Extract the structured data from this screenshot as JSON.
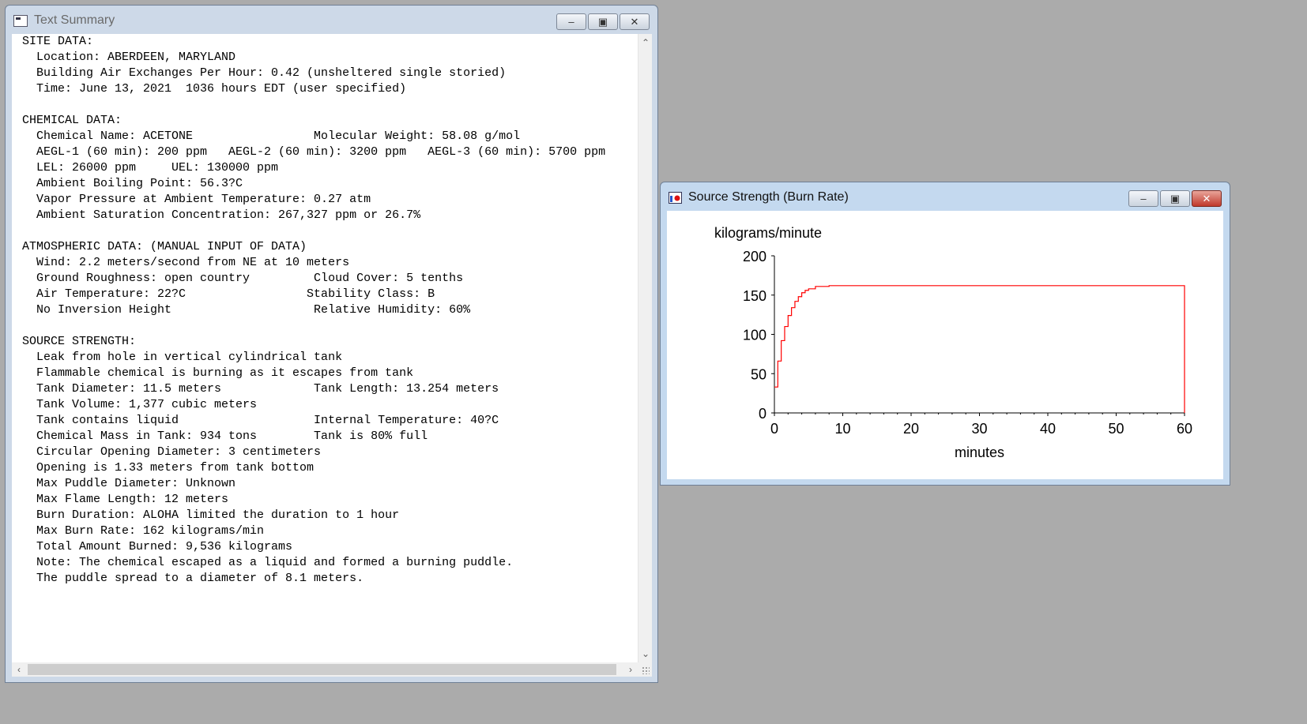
{
  "text_window": {
    "title": "Text Summary",
    "lines": [
      "SITE DATA:",
      "  Location: ABERDEEN, MARYLAND",
      "  Building Air Exchanges Per Hour: 0.42 (unsheltered single storied)",
      "  Time: June 13, 2021  1036 hours EDT (user specified)",
      "",
      "CHEMICAL DATA:",
      "  Chemical Name: ACETONE                 Molecular Weight: 58.08 g/mol",
      "  AEGL-1 (60 min): 200 ppm   AEGL-2 (60 min): 3200 ppm   AEGL-3 (60 min): 5700 ppm",
      "  LEL: 26000 ppm     UEL: 130000 ppm",
      "  Ambient Boiling Point: 56.3?C",
      "  Vapor Pressure at Ambient Temperature: 0.27 atm",
      "  Ambient Saturation Concentration: 267,327 ppm or 26.7%",
      "",
      "ATMOSPHERIC DATA: (MANUAL INPUT OF DATA)",
      "  Wind: 2.2 meters/second from NE at 10 meters",
      "  Ground Roughness: open country         Cloud Cover: 5 tenths",
      "  Air Temperature: 22?C                 Stability Class: B",
      "  No Inversion Height                    Relative Humidity: 60%",
      "",
      "SOURCE STRENGTH:",
      "  Leak from hole in vertical cylindrical tank",
      "  Flammable chemical is burning as it escapes from tank",
      "  Tank Diameter: 11.5 meters             Tank Length: 13.254 meters",
      "  Tank Volume: 1,377 cubic meters",
      "  Tank contains liquid                   Internal Temperature: 40?C",
      "  Chemical Mass in Tank: 934 tons        Tank is 80% full",
      "  Circular Opening Diameter: 3 centimeters",
      "  Opening is 1.33 meters from tank bottom",
      "  Max Puddle Diameter: Unknown",
      "  Max Flame Length: 12 meters",
      "  Burn Duration: ALOHA limited the duration to 1 hour",
      "  Max Burn Rate: 162 kilograms/min",
      "  Total Amount Burned: 9,536 kilograms",
      "  Note: The chemical escaped as a liquid and formed a burning puddle.",
      "  The puddle spread to a diameter of 8.1 meters."
    ]
  },
  "chart_window": {
    "title": "Source Strength (Burn Rate)"
  },
  "icons": {
    "minimize": "minimize-icon",
    "maximize": "maximize-icon",
    "close": "close-icon"
  },
  "colors": {
    "series": "#ff0000",
    "desktop": "#ababab"
  },
  "chart_data": {
    "type": "line",
    "title": "",
    "ylabel": "kilograms/minute",
    "xlabel": "minutes",
    "xlim": [
      0,
      60
    ],
    "ylim": [
      0,
      200
    ],
    "x_ticks": [
      0,
      10,
      20,
      30,
      40,
      50,
      60
    ],
    "y_ticks": [
      0,
      50,
      100,
      150,
      200
    ],
    "grid": false,
    "series": [
      {
        "step": true,
        "x": [
          0,
          0.5,
          1,
          1.5,
          2,
          2.5,
          3,
          3.5,
          4,
          4.5,
          5,
          6,
          8,
          60,
          60
        ],
        "y": [
          33,
          66,
          92,
          110,
          124,
          134,
          142,
          148,
          153,
          156,
          158,
          161,
          162,
          162,
          0
        ]
      }
    ]
  }
}
